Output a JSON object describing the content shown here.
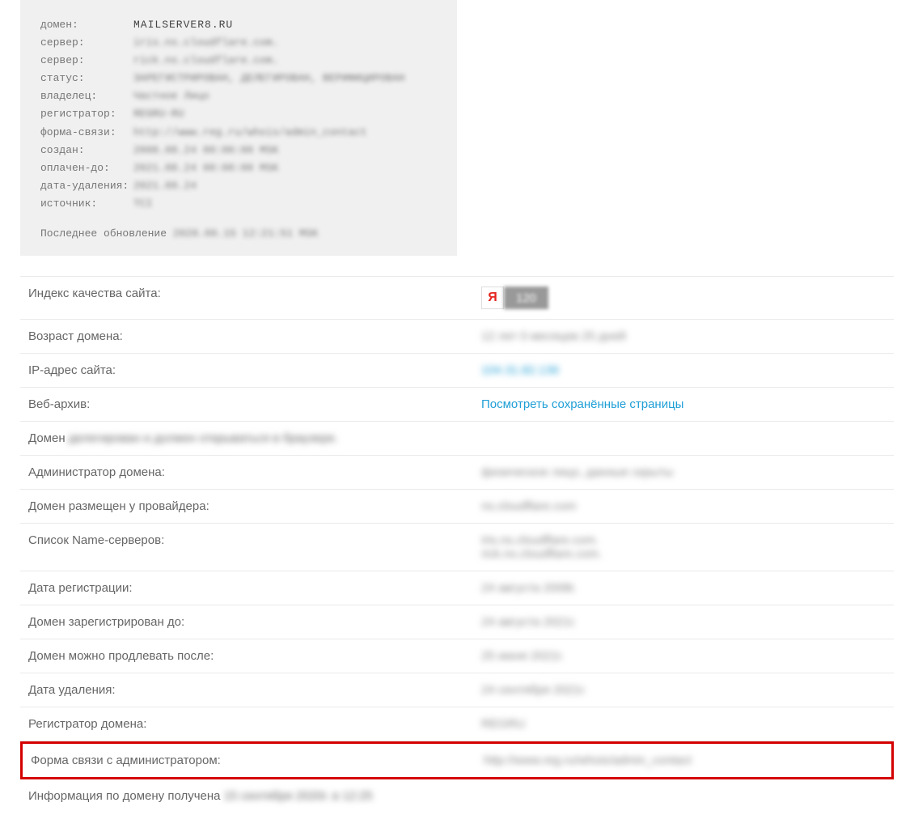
{
  "whois": {
    "rows": [
      {
        "label": "домен:",
        "value": "MAILSERVER8.RU",
        "clear": true
      },
      {
        "label": "сервер:",
        "value": "iris.ns.cloudflare.com."
      },
      {
        "label": "сервер:",
        "value": "rick.ns.cloudflare.com."
      },
      {
        "label": "статус:",
        "value": "ЗАРЕГИСТРИРОВАН, ДЕЛЕГИРОВАН, ВЕРИФИЦИРОВАН"
      },
      {
        "label": "владелец:",
        "value": "Частное Лицо"
      },
      {
        "label": "регистратор:",
        "value": "REGRU-RU"
      },
      {
        "label": "форма-связи:",
        "value": "http://www.reg.ru/whois/admin_contact"
      },
      {
        "label": "создан:",
        "value": "2008.08.24 00:00:00 MSK"
      },
      {
        "label": "оплачен-до:",
        "value": "2021.08.24 00:00:00 MSK"
      },
      {
        "label": "дата-удаления:",
        "value": "2021.09.24"
      },
      {
        "label": "источник:",
        "value": "TCI"
      }
    ],
    "update_label": "Последнее обновление",
    "update_value": "2020.09.15 12:21:51 MSK"
  },
  "table": {
    "rows": [
      {
        "label": "Индекс качества сайта:",
        "type": "badge",
        "badge_val": "120"
      },
      {
        "label": "Возраст домена:",
        "value": "12 лет 0 месяцев 25 дней",
        "blurred": true
      },
      {
        "label": "IP-адрес сайта:",
        "value": "104.31.82.136",
        "blurred": true,
        "link": true
      },
      {
        "label": "Веб-архив:",
        "value": "Посмотреть сохранённые страницы",
        "link": true
      },
      {
        "label_prefix": "Домен ",
        "label_blur": "делегирован и должен открываться в браузере.",
        "single": true
      },
      {
        "label": "Администратор домена:",
        "value": "физическое лицо, данные скрыты",
        "blurred": true
      },
      {
        "label": "Домен размещен у провайдера:",
        "value": "ns.cloudflare.com",
        "blurred": true
      },
      {
        "label": "Список Name-серверов:",
        "value": "iris.ns.cloudflare.com.",
        "value2": "rick.ns.cloudflare.com.",
        "blurred": true
      },
      {
        "label": "Дата регистрации:",
        "value": "24 августа 2008г.",
        "blurred": true
      },
      {
        "label": "Домен зарегистрирован до:",
        "value": "24 августа 2021г.",
        "blurred": true
      },
      {
        "label": "Домен можно продлевать после:",
        "value": "25 июня 2021г.",
        "blurred": true
      },
      {
        "label": "Дата удаления:",
        "value": "24 сентября 2021г.",
        "blurred": true
      },
      {
        "label": "Регистратор домена:",
        "value": "REGRU",
        "blurred": true
      },
      {
        "label": "Форма связи с администратором:",
        "value": "http://www.reg.ru/whois/admin_contact",
        "blurred": true,
        "highlight": true
      },
      {
        "label_prefix": "Информация по домену получена ",
        "label_blur": "15 сентября 2020г. в 12:25",
        "single": true,
        "noborder": true
      }
    ]
  },
  "yandex_letter": "Я"
}
